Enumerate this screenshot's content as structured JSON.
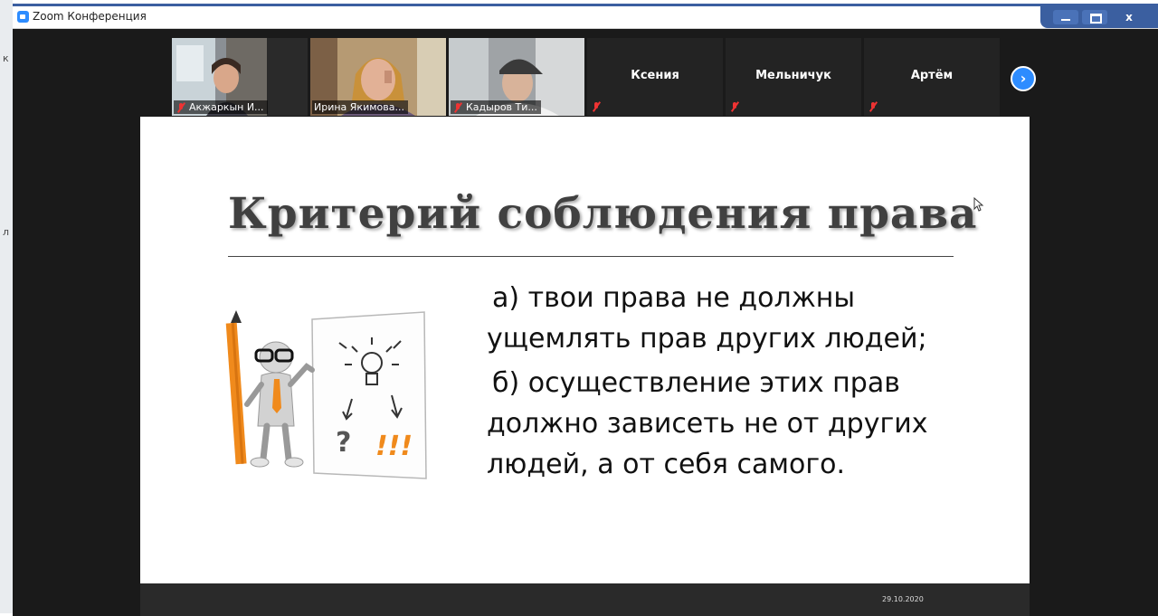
{
  "window": {
    "title": "Zoom Конференция",
    "close_label": "x"
  },
  "desktop": {
    "edge_glyphs": [
      "к",
      "л"
    ]
  },
  "participants": [
    {
      "name": "Акжаркын И...",
      "muted": true,
      "video": true
    },
    {
      "name": "Ирина Якимова...",
      "muted": false,
      "video": true
    },
    {
      "name": "Кадыров Ти...",
      "muted": true,
      "video": true,
      "active_speaker": true
    },
    {
      "name": "Ксения",
      "muted": true,
      "video": false
    },
    {
      "name": "Мельничук",
      "muted": true,
      "video": false
    },
    {
      "name": "Артём",
      "muted": true,
      "video": false
    }
  ],
  "next_page_icon": "chevron-right-icon",
  "slide": {
    "title": "Критерий соблюдения права",
    "point_a": "а) твои права не должны ущемлять прав других людей;",
    "point_b": "б) осуществление этих прав должно зависеть не от других людей, а от себя самого.",
    "illustration_marks": {
      "question": "?",
      "exclamation": "!!!"
    },
    "date": "29.10.2020"
  },
  "colors": {
    "titlebar_accent": "#3b5fa0",
    "zoom_blue": "#2d8cff",
    "active_speaker": "#6fbf3a",
    "muted_red": "#ee3333",
    "pencil_orange": "#f08a1c"
  }
}
